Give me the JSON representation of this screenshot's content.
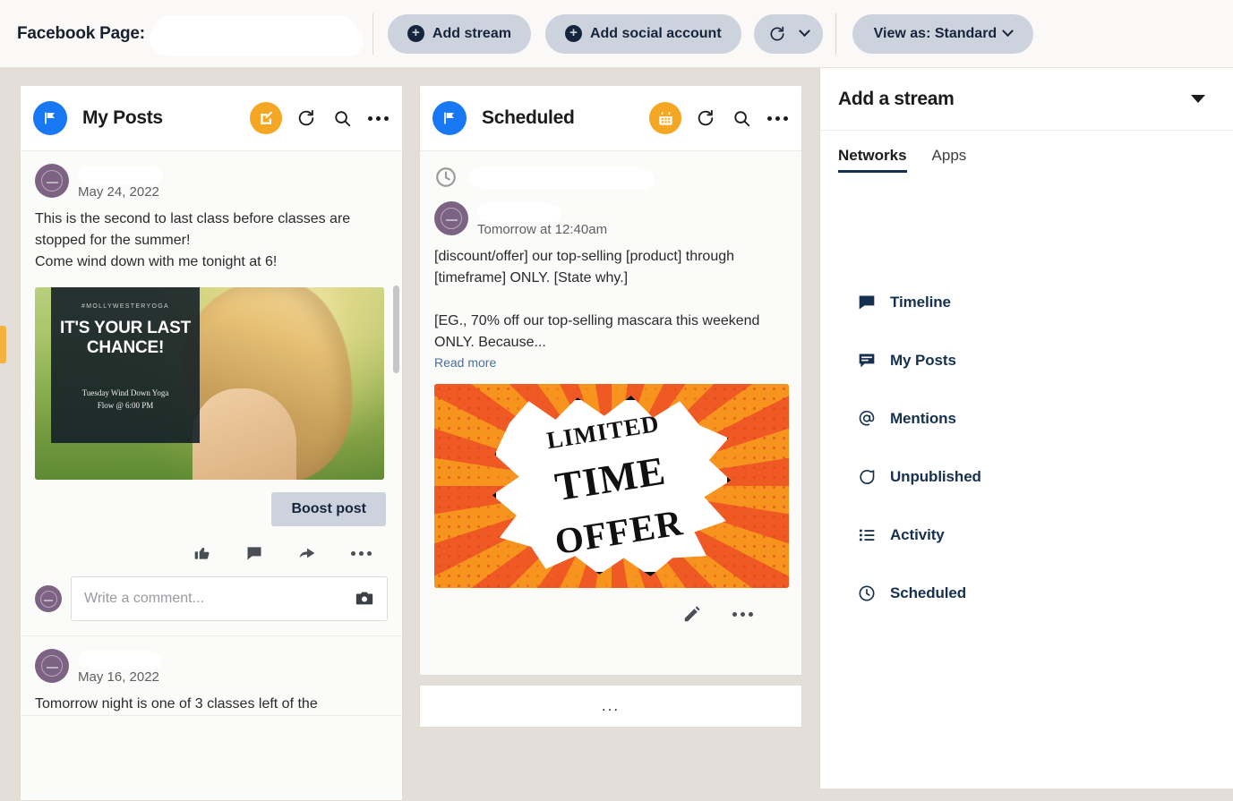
{
  "topbar": {
    "page_label": "Facebook Page:",
    "page_name_redacted": "",
    "add_stream": "Add stream",
    "add_social_account": "Add social account",
    "refresh_icon": "refresh-icon",
    "refresh_caret_icon": "chevron-down-icon",
    "view_as": "View as: Standard"
  },
  "columns": [
    {
      "id": "my-posts",
      "title": "My Posts",
      "network_icon": "facebook-flag-icon",
      "primary_action_icon": "compose-icon",
      "primary_action_color": "#f5a623",
      "refresh_icon": "refresh-icon",
      "search_icon": "search-icon",
      "more_icon": "ellipsis-icon",
      "posts": [
        {
          "author_redacted": "",
          "date": "May 24, 2022",
          "text": "This is the second to last class before classes are stopped for the summer!\nCome wind down with me tonight at 6!",
          "image": {
            "kicker": "#MOLLYWESTERYOGA",
            "title": "IT'S YOUR LAST CHANCE!",
            "subtitle": "Tuesday Wind Down Yoga\nFlow @ 6:00 PM"
          },
          "boost_label": "Boost post",
          "actions": [
            "like-icon",
            "comment-icon",
            "share-icon",
            "ellipsis-icon"
          ],
          "comment_placeholder": "Write a comment...",
          "comment_value": "",
          "camera_icon": "camera-icon"
        },
        {
          "author_redacted": "",
          "date": "May 16, 2022",
          "text": "Tomorrow night is one of 3 classes left of the"
        }
      ]
    },
    {
      "id": "scheduled",
      "title": "Scheduled",
      "network_icon": "facebook-flag-icon",
      "primary_action_icon": "calendar-icon",
      "primary_action_color": "#f5a623",
      "refresh_icon": "refresh-icon",
      "search_icon": "search-icon",
      "more_icon": "ellipsis-icon",
      "schedule_header_icon": "clock-icon",
      "schedule_header_redacted": "",
      "posts": [
        {
          "author_redacted": "",
          "date": "Tomorrow at 12:40am",
          "text": "[discount/offer] our top-selling [product] through [timeframe] ONLY. [State why.]\n\n[EG., 70% off our top-selling mascara this weekend ONLY. Because...",
          "read_more": "Read more",
          "image": {
            "line1": "LIMITED",
            "line2": "TIME",
            "line3": "OFFER"
          },
          "actions": [
            "edit-icon",
            "ellipsis-icon"
          ]
        }
      ],
      "loading_indicator": "..."
    }
  ],
  "right_panel": {
    "title": "Add a stream",
    "collapse_icon": "caret-down-icon",
    "tabs": [
      {
        "label": "Networks",
        "active": true
      },
      {
        "label": "Apps",
        "active": false
      }
    ],
    "items": [
      {
        "label": "Timeline",
        "icon": "comment-filled-icon"
      },
      {
        "label": "My Posts",
        "icon": "comment-lines-icon"
      },
      {
        "label": "Mentions",
        "icon": "at-icon"
      },
      {
        "label": "Unpublished",
        "icon": "comment-outline-icon"
      },
      {
        "label": "Activity",
        "icon": "list-icon"
      },
      {
        "label": "Scheduled",
        "icon": "clock-icon"
      }
    ]
  },
  "colors": {
    "background": "#e3ded7",
    "accent_orange": "#f5a623",
    "accent_navy": "#16314f",
    "pill": "#ccd3dd",
    "facebook_blue": "#1877f2",
    "left_tab_marker": "#f4b23e"
  }
}
